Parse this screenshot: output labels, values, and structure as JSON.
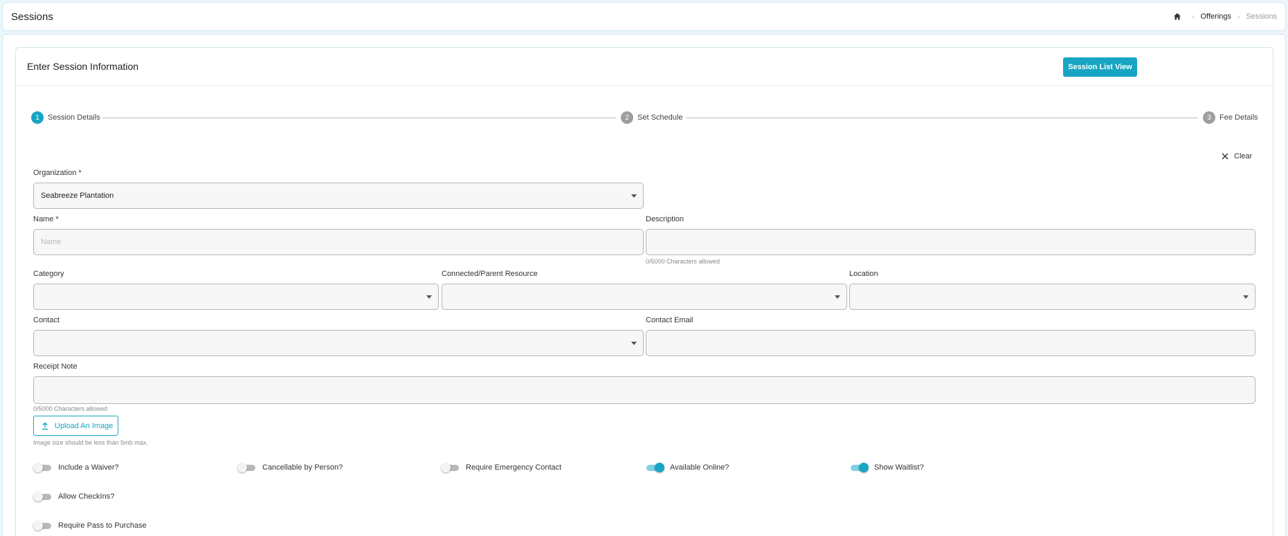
{
  "header": {
    "title": "Sessions",
    "breadcrumb": {
      "home_icon": "home-icon",
      "link": "Offerings",
      "current": "Sessions"
    }
  },
  "card": {
    "title": "Enter Session Information",
    "list_view_button": "Session List View"
  },
  "stepper": [
    {
      "number": "1",
      "label": "Session Details",
      "state": "active"
    },
    {
      "number": "2",
      "label": "Set Schedule",
      "state": "inactive"
    },
    {
      "number": "3",
      "label": "Fee Details",
      "state": "inactive"
    }
  ],
  "clear_label": "Clear",
  "form": {
    "organization": {
      "label": "Organization *",
      "value": "Seabreeze Plantation"
    },
    "name": {
      "label": "Name *",
      "placeholder": "Name",
      "value": ""
    },
    "description": {
      "label": "Description",
      "value": "",
      "hint": "0/5000 Characters allowed"
    },
    "category": {
      "label": "Category",
      "value": ""
    },
    "parent_resource": {
      "label": "Connected/Parent Resource",
      "value": ""
    },
    "location": {
      "label": "Location",
      "value": ""
    },
    "contact": {
      "label": "Contact",
      "value": ""
    },
    "contact_email": {
      "label": "Contact Email",
      "value": ""
    },
    "receipt_note": {
      "label": "Receipt Note",
      "value": "",
      "hint": "0/5000 Characters allowed"
    },
    "upload": {
      "label": "Upload An Image",
      "hint": "Image size should be less than 5mb max."
    }
  },
  "toggles": {
    "waiver": {
      "label": "Include a Waiver?",
      "on": false
    },
    "cancellable": {
      "label": "Cancellable by Person?",
      "on": false
    },
    "emergency": {
      "label": "Require Emergency Contact",
      "on": false
    },
    "online": {
      "label": "Available Online?",
      "on": true
    },
    "waitlist": {
      "label": "Show Waitlist?",
      "on": true
    },
    "checkins": {
      "label": "Allow CheckIns?",
      "on": false
    },
    "pass": {
      "label": "Require Pass to Purchase",
      "on": false
    }
  },
  "colors": {
    "accent": "#17a5c3",
    "page_bg": "#eaf6fa",
    "border": "#cfe7ef"
  }
}
